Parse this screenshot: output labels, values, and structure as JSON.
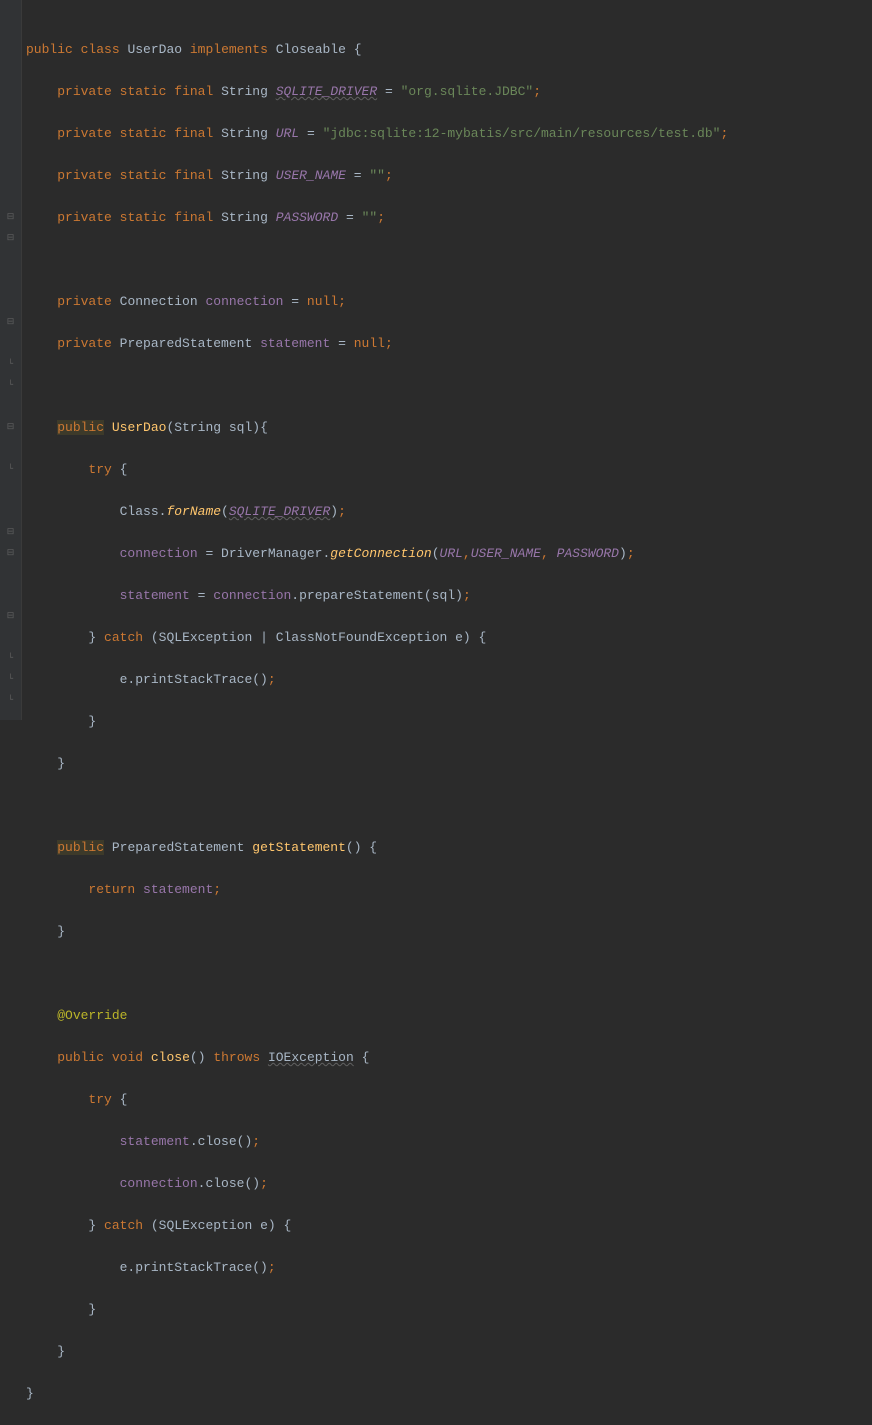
{
  "gutter": {
    "icons": {
      "collapse": "⊟",
      "expand": "⊞",
      "marker": "◦",
      "end": "└"
    }
  },
  "code": {
    "t0_1": "public",
    "t0_2": "class",
    "t0_3": "UserDao",
    "t0_4": "implements",
    "t0_5": "Closeable",
    "t0_6": "{",
    "t1_1": "private",
    "t1_2": "static",
    "t1_3": "final",
    "t1_4": "String",
    "t1_5": "SQLITE_DRIVER",
    "t1_6": "=",
    "t1_7": "\"org.sqlite.JDBC\"",
    "t1_8": ";",
    "t2_1": "private",
    "t2_2": "static",
    "t2_3": "final",
    "t2_4": "String",
    "t2_5": "URL",
    "t2_6": "=",
    "t2_7": "\"jdbc:sqlite:12-mybatis/src/main/resources/test.db\"",
    "t2_8": ";",
    "t3_1": "private",
    "t3_2": "static",
    "t3_3": "final",
    "t3_4": "String",
    "t3_5": "USER_NAME",
    "t3_6": "=",
    "t3_7": "\"\"",
    "t3_8": ";",
    "t4_1": "private",
    "t4_2": "static",
    "t4_3": "final",
    "t4_4": "String",
    "t4_5": "PASSWORD",
    "t4_6": "=",
    "t4_7": "\"\"",
    "t4_8": ";",
    "t6_1": "private",
    "t6_2": "Connection",
    "t6_3": "connection",
    "t6_4": "=",
    "t6_5": "null",
    "t6_6": ";",
    "t7_1": "private",
    "t7_2": "PreparedStatement",
    "t7_3": "statement",
    "t7_4": "=",
    "t7_5": "null",
    "t7_6": ";",
    "t9_1": "public",
    "t9_2": "UserDao",
    "t9_3": "(String sql)",
    "t9_4": "{",
    "t10_1": "try",
    "t10_2": "{",
    "t11_1": "Class.",
    "t11_2": "forName",
    "t11_3": "(",
    "t11_4": "SQLITE_DRIVER",
    "t11_5": ")",
    "t11_6": ";",
    "t12_1": "connection",
    "t12_2": "= DriverManager.",
    "t12_3": "getConnection",
    "t12_4": "(",
    "t12_5": "URL",
    "t12_6": ",",
    "t12_7": "USER_NAME",
    "t12_8": ",",
    "t12_9": "PASSWORD",
    "t12_10": ")",
    "t12_11": ";",
    "t13_1": "statement",
    "t13_2": "=",
    "t13_3": "connection",
    "t13_4": ".prepareStatement(sql)",
    "t13_5": ";",
    "t14_1": "}",
    "t14_2": "catch",
    "t14_3": "(SQLException | ClassNotFoundException e) {",
    "t15_1": "e.printStackTrace()",
    "t15_2": ";",
    "t16_1": "}",
    "t17_1": "}",
    "t19_1": "public",
    "t19_2": "PreparedStatement",
    "t19_3": "getStatement",
    "t19_4": "() {",
    "t20_1": "return",
    "t20_2": "statement",
    "t20_3": ";",
    "t21_1": "}",
    "t23_1": "@Override",
    "t24_1": "public",
    "t24_2": "void",
    "t24_3": "close",
    "t24_4": "()",
    "t24_5": "throws",
    "t24_6": "IOException",
    "t24_7": "{",
    "t25_1": "try",
    "t25_2": "{",
    "t26_1": "statement",
    "t26_2": ".close()",
    "t26_3": ";",
    "t27_1": "connection",
    "t27_2": ".close()",
    "t27_3": ";",
    "t28_1": "}",
    "t28_2": "catch",
    "t28_3": "(SQLException e) {",
    "t29_1": "e.printStackTrace()",
    "t29_2": ";",
    "t30_1": "}",
    "t31_1": "}",
    "t32_1": "}"
  }
}
